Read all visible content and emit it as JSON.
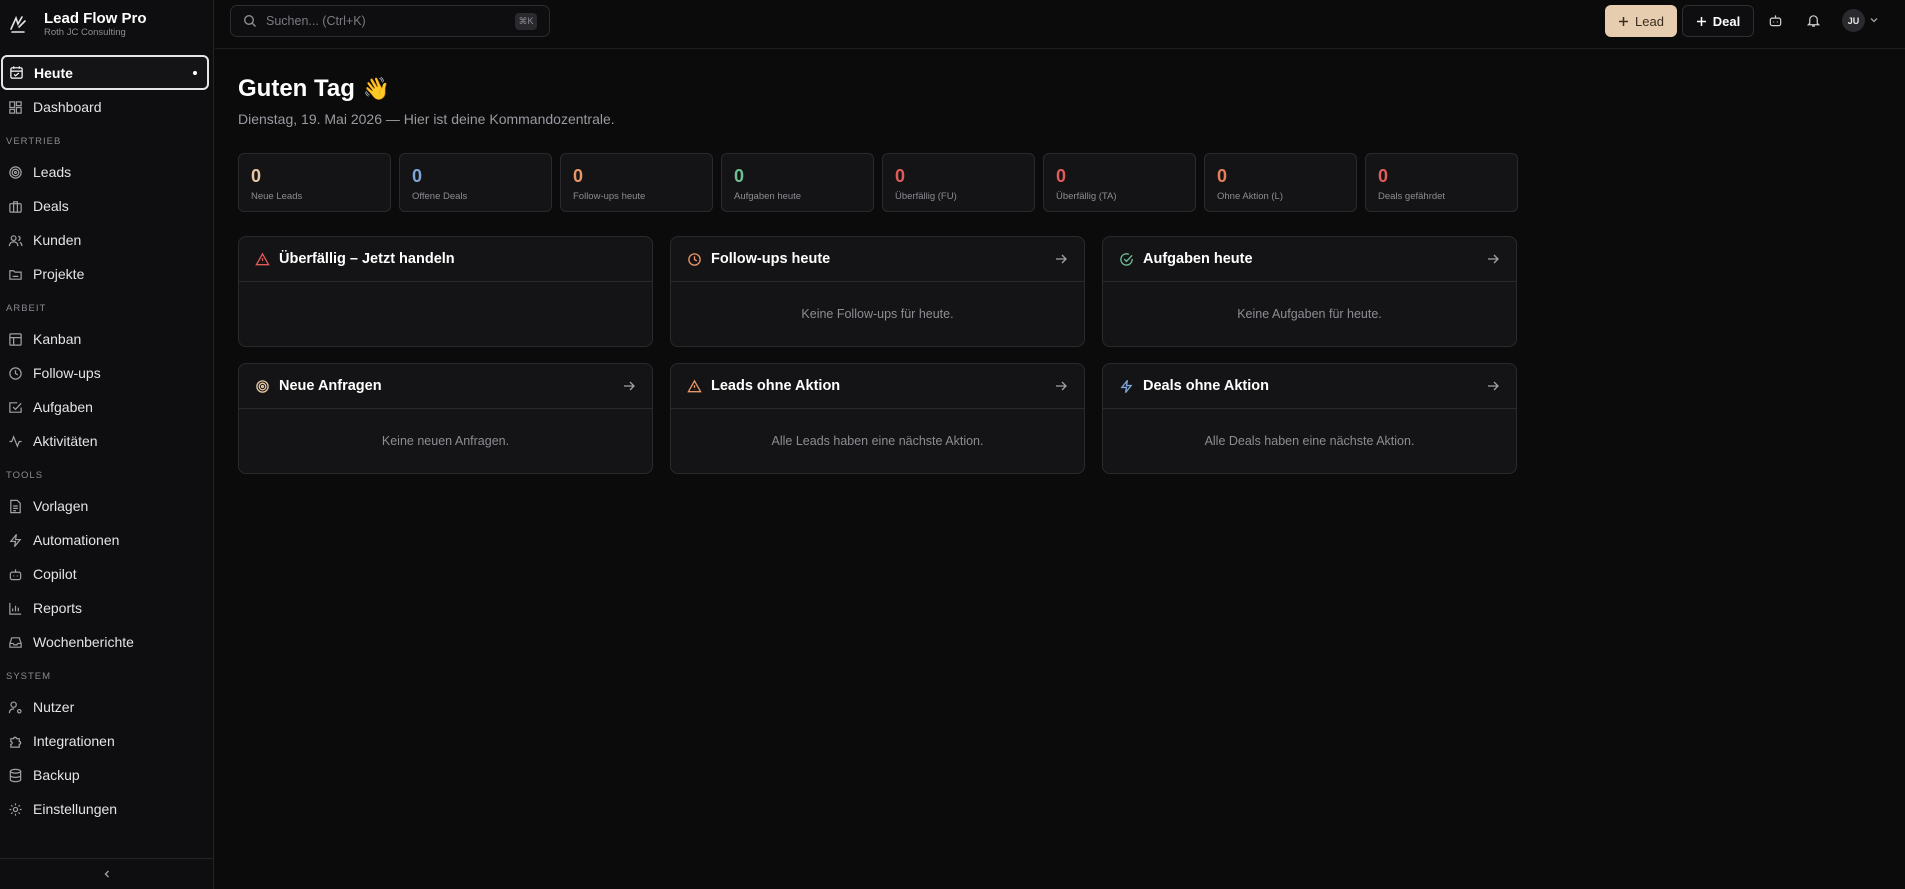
{
  "brand": {
    "title": "Lead Flow Pro",
    "subtitle": "Roth JC Consulting"
  },
  "search": {
    "placeholder": "Suchen... (Ctrl+K)",
    "shortcut": "⌘K"
  },
  "topbar": {
    "lead_label": "Lead",
    "deal_label": "Deal",
    "avatar_initials": "JU"
  },
  "nav": {
    "top": [
      {
        "label": "Heute",
        "icon": "calendar-icon",
        "active": true
      },
      {
        "label": "Dashboard",
        "icon": "grid-icon"
      }
    ],
    "sections": [
      {
        "title": "VERTRIEB",
        "items": [
          {
            "label": "Leads",
            "icon": "target-icon"
          },
          {
            "label": "Deals",
            "icon": "briefcase-icon"
          },
          {
            "label": "Kunden",
            "icon": "users-icon"
          },
          {
            "label": "Projekte",
            "icon": "folder-icon"
          }
        ]
      },
      {
        "title": "ARBEIT",
        "items": [
          {
            "label": "Kanban",
            "icon": "kanban-icon"
          },
          {
            "label": "Follow-ups",
            "icon": "clock-icon"
          },
          {
            "label": "Aufgaben",
            "icon": "check-square-icon"
          },
          {
            "label": "Aktivitäten",
            "icon": "activity-icon"
          }
        ]
      },
      {
        "title": "TOOLS",
        "items": [
          {
            "label": "Vorlagen",
            "icon": "file-text-icon"
          },
          {
            "label": "Automationen",
            "icon": "zap-icon"
          },
          {
            "label": "Copilot",
            "icon": "bot-icon"
          },
          {
            "label": "Reports",
            "icon": "bar-chart-icon"
          },
          {
            "label": "Wochenberichte",
            "icon": "inbox-icon"
          }
        ]
      },
      {
        "title": "SYSTEM",
        "items": [
          {
            "label": "Nutzer",
            "icon": "user-cog-icon"
          },
          {
            "label": "Integrationen",
            "icon": "puzzle-icon"
          },
          {
            "label": "Backup",
            "icon": "database-icon"
          },
          {
            "label": "Einstellungen",
            "icon": "gear-icon"
          }
        ]
      }
    ]
  },
  "main": {
    "greeting": "Guten Tag",
    "greeting_emoji": "👋",
    "subtitle": "Dienstag, 19. Mai 2026 — Hier ist deine Kommandozentrale.",
    "stats": [
      {
        "value": "0",
        "label": "Neue Leads",
        "color": "#e7c6a2"
      },
      {
        "value": "0",
        "label": "Offene Deals",
        "color": "#7fa6d6"
      },
      {
        "value": "0",
        "label": "Follow-ups heute",
        "color": "#e89668"
      },
      {
        "value": "0",
        "label": "Aufgaben heute",
        "color": "#6fbf93"
      },
      {
        "value": "0",
        "label": "Überfällig (FU)",
        "color": "#e15b5b"
      },
      {
        "value": "0",
        "label": "Überfällig (TA)",
        "color": "#e15b5b"
      },
      {
        "value": "0",
        "label": "Ohne Aktion (L)",
        "color": "#e87d5a"
      },
      {
        "value": "0",
        "label": "Deals gefährdet",
        "color": "#e15b5b"
      }
    ],
    "cards": [
      {
        "title": "Überfällig – Jetzt handeln",
        "icon": "alert-triangle-icon",
        "icon_color": "#e15b5b",
        "empty": "",
        "has_arrow": false
      },
      {
        "title": "Follow-ups heute",
        "icon": "clock-icon",
        "icon_color": "#e89668",
        "empty": "Keine Follow-ups für heute.",
        "has_arrow": true
      },
      {
        "title": "Aufgaben heute",
        "icon": "check-circle-icon",
        "icon_color": "#6fbf93",
        "empty": "Keine Aufgaben für heute.",
        "has_arrow": true
      },
      {
        "title": "Neue Anfragen",
        "icon": "target-icon",
        "icon_color": "#e7c6a2",
        "empty": "Keine neuen Anfragen.",
        "has_arrow": true
      },
      {
        "title": "Leads ohne Aktion",
        "icon": "alert-triangle-icon",
        "icon_color": "#e89668",
        "empty": "Alle Leads haben eine nächste Aktion.",
        "has_arrow": true
      },
      {
        "title": "Deals ohne Aktion",
        "icon": "zap-icon",
        "icon_color": "#7fa6d6",
        "empty": "Alle Deals haben eine nächste Aktion.",
        "has_arrow": true
      }
    ]
  }
}
